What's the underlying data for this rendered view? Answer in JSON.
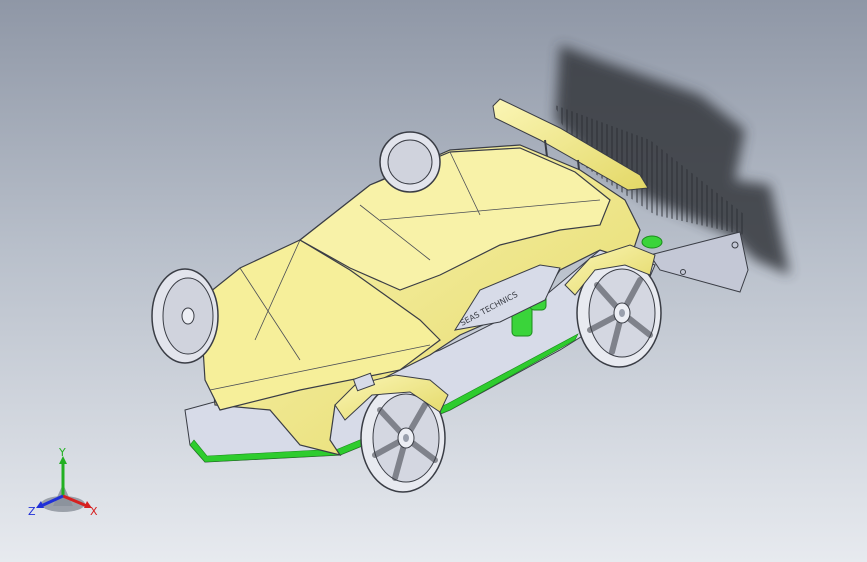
{
  "viewport": {
    "background_top": "#8f97a6",
    "background_bottom": "#e7eaef"
  },
  "model": {
    "body_color": "#f2eb8a",
    "chassis_color": "#d7dbe8",
    "accent_color": "#2ecc2e",
    "wheel_color": "#d9dbe3",
    "shadow_color": "#3c3f46",
    "decal_text": "SEAS TECHNICS"
  },
  "triad": {
    "x_label": "X",
    "y_label": "Y",
    "z_label": "Z",
    "x_color": "#d62020",
    "y_color": "#22b022",
    "z_color": "#2030d8"
  }
}
